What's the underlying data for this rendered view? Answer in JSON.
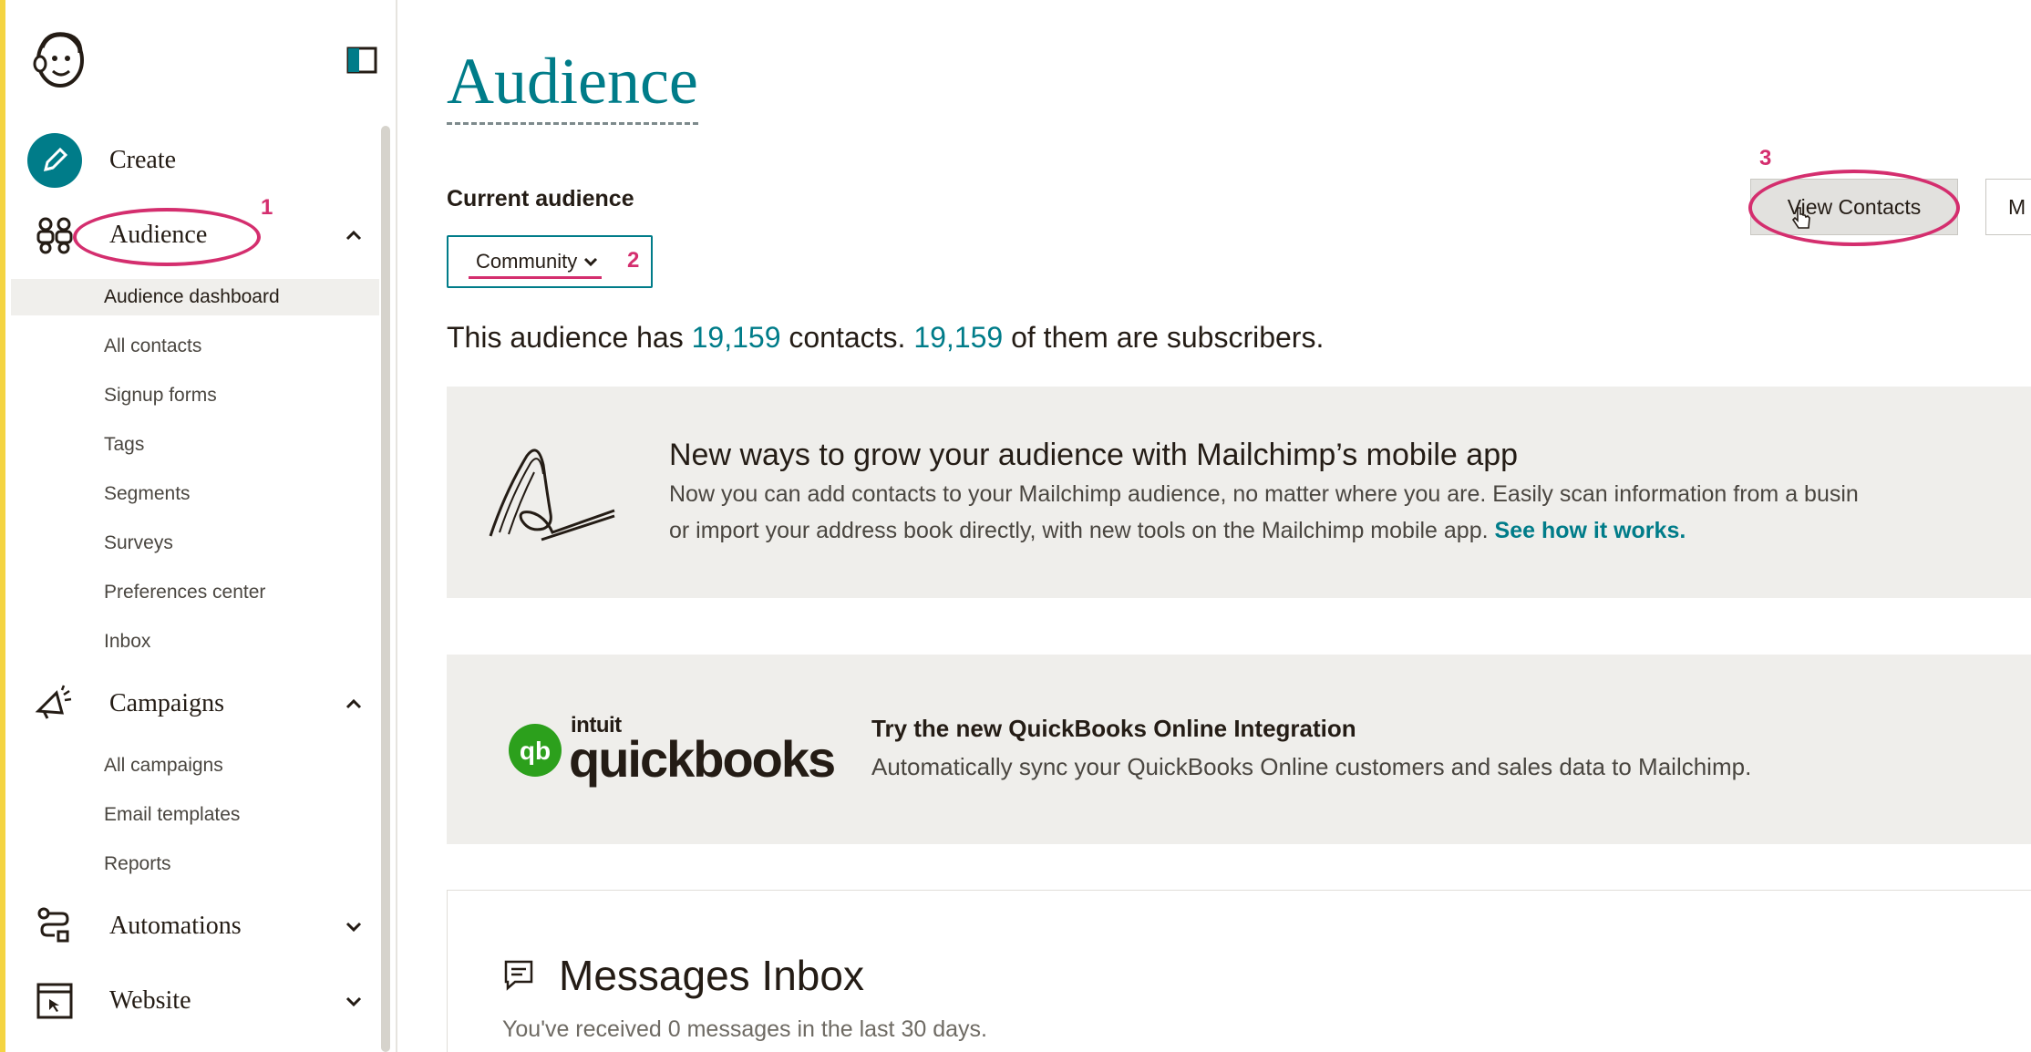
{
  "sidebar": {
    "nav": [
      {
        "label": "Create",
        "icon": "pencil-icon"
      },
      {
        "label": "Audience",
        "icon": "audience-icon",
        "chevron": "up"
      },
      {
        "label": "Campaigns",
        "icon": "megaphone-icon",
        "chevron": "up"
      },
      {
        "label": "Automations",
        "icon": "automations-icon",
        "chevron": "down"
      },
      {
        "label": "Website",
        "icon": "website-icon",
        "chevron": "down"
      }
    ],
    "audience_items": [
      "Audience dashboard",
      "All contacts",
      "Signup forms",
      "Tags",
      "Segments",
      "Surveys",
      "Preferences center",
      "Inbox"
    ],
    "campaign_items": [
      "All campaigns",
      "Email templates",
      "Reports"
    ],
    "active_item": "Audience dashboard"
  },
  "main": {
    "title": "Audience",
    "current_audience_label": "Current audience",
    "selected_audience": "Community",
    "summary": {
      "prefix": "This audience has",
      "contacts": "19,159",
      "middle": "contacts.",
      "subscribers": "19,159",
      "suffix": "of them are subscribers."
    },
    "view_contacts_label": "View Contacts",
    "more_button_label": "M",
    "mobile_card": {
      "heading": "New ways to grow your audience with Mailchimp’s mobile app",
      "line1": "Now you can add contacts to your Mailchimp audience, no matter where you are. Easily scan information from a busin",
      "line2": "or import your address book directly, with new tools on the Mailchimp mobile app.",
      "link": "See how it works."
    },
    "quickbooks_card": {
      "logo_brand": "intuit",
      "logo_word": "quickbooks",
      "logo_mark": "qb",
      "heading": "Try the new QuickBooks Online Integration",
      "body": "Automatically sync your QuickBooks Online customers and sales data to Mailchimp."
    },
    "inbox": {
      "title": "Messages Inbox",
      "subtitle": "You've received 0 messages in the last 30 days."
    }
  },
  "annotations": {
    "step1": "1",
    "step2": "2",
    "step3": "3"
  },
  "colors": {
    "accent": "#007c89",
    "annotation": "#d42e6e",
    "edge": "#f4d442",
    "card_bg": "#efeeeb"
  }
}
